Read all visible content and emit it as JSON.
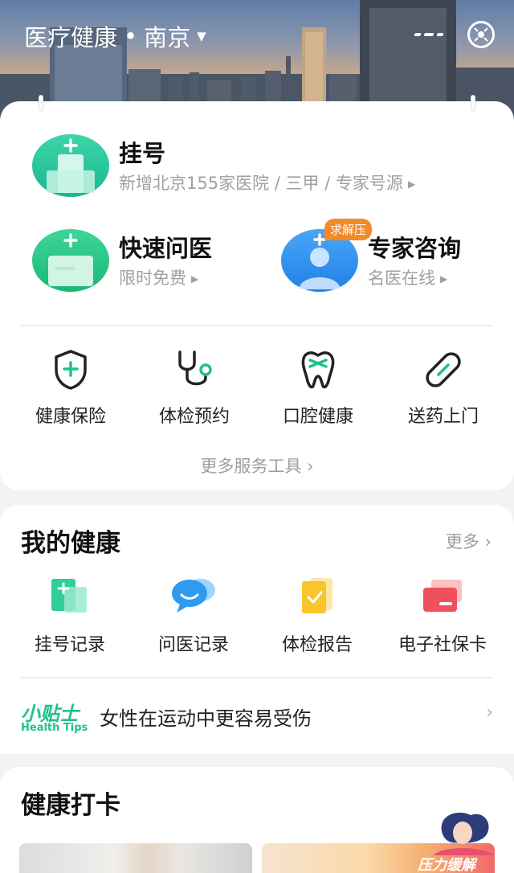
{
  "header": {
    "title": "医疗健康",
    "separator": "•",
    "city": "南京",
    "caret": "▼"
  },
  "services": {
    "registration": {
      "title": "挂号",
      "subtitle": "新增北京155家医院 / 三甲 / 专家号源",
      "arrow": "▶"
    },
    "quick_consult": {
      "title": "快速问医",
      "subtitle": "限时免费",
      "arrow": "▶"
    },
    "expert_consult": {
      "title": "专家咨询",
      "subtitle": "名医在线",
      "arrow": "▶",
      "badge": "求解压"
    }
  },
  "tools": [
    {
      "label": "健康保险",
      "icon": "shield-plus-icon"
    },
    {
      "label": "体检预约",
      "icon": "stethoscope-icon"
    },
    {
      "label": "口腔健康",
      "icon": "tooth-icon"
    },
    {
      "label": "送药上门",
      "icon": "pill-icon"
    }
  ],
  "more_tools": "更多服务工具 ›",
  "my_health": {
    "title": "我的健康",
    "more": "更多 ›",
    "records": [
      {
        "label": "挂号记录",
        "icon": "registration-record-icon"
      },
      {
        "label": "问医记录",
        "icon": "chat-bubble-icon"
      },
      {
        "label": "体检报告",
        "icon": "report-icon"
      },
      {
        "label": "电子社保卡",
        "icon": "social-card-icon"
      }
    ]
  },
  "tips": {
    "logo_cn": "小贴士",
    "logo_en": "Health Tips",
    "text": "女性在运动中更容易受伤",
    "chevron": "›"
  },
  "checkin": {
    "title": "健康打卡",
    "stress_label": "压力缓解"
  },
  "colors": {
    "accent_green": "#1ec18b",
    "accent_blue": "#2e8ff0",
    "badge_orange": "#f28a2a"
  }
}
